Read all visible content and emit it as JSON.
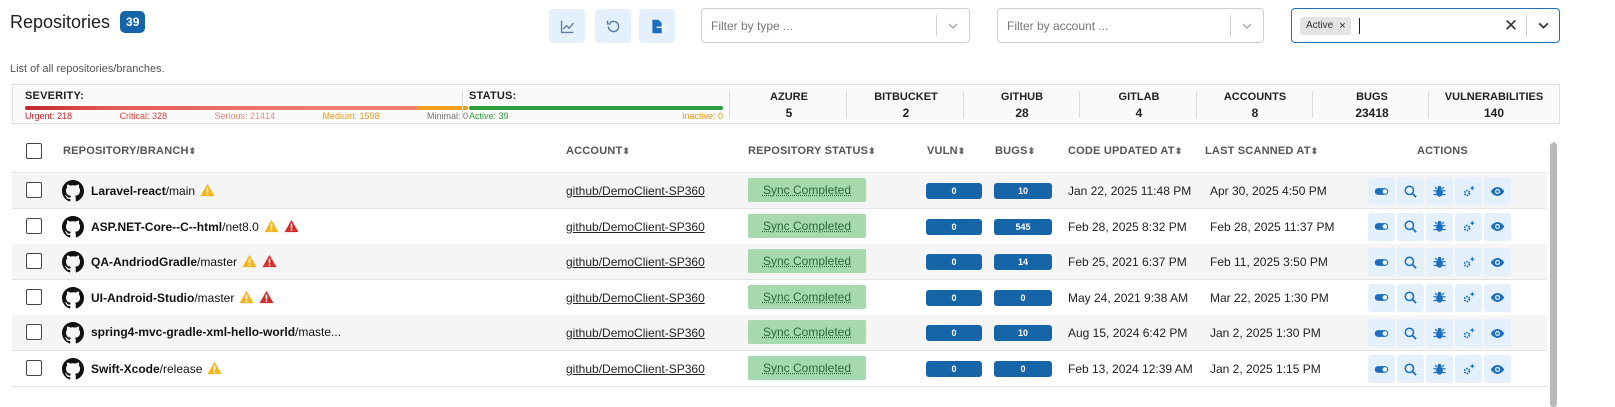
{
  "header": {
    "title": "Repositories",
    "count": "39",
    "subtitle": "List of all repositories/branches."
  },
  "toolbar": {
    "buttons": [
      {
        "icon": "chart-line-icon"
      },
      {
        "icon": "refresh-icon"
      },
      {
        "icon": "export-icon"
      }
    ]
  },
  "filters": {
    "type_placeholder": "Filter by type ...",
    "account_placeholder": "Filter by account ...",
    "status_chip": "Active",
    "status_chip_remove": "×",
    "status_clear": "✕"
  },
  "summary": {
    "severity_label": "SEVERITY:",
    "severity": [
      {
        "label": "Urgent: 218"
      },
      {
        "label": "Critical: 328"
      },
      {
        "label": "Serious: 21414"
      },
      {
        "label": "Medium: 1598"
      },
      {
        "label": "Minimal: 0"
      }
    ],
    "status_label": "STATUS:",
    "status_active": "Active: 39",
    "status_inactive": "Inactive: 0",
    "stats": [
      {
        "label": "AZURE",
        "value": "5"
      },
      {
        "label": "BITBUCKET",
        "value": "2"
      },
      {
        "label": "GITHUB",
        "value": "28"
      },
      {
        "label": "GITLAB",
        "value": "4"
      },
      {
        "label": "ACCOUNTS",
        "value": "8"
      },
      {
        "label": "BUGS",
        "value": "23418"
      },
      {
        "label": "VULNERABILITIES",
        "value": "140"
      }
    ]
  },
  "table": {
    "columns": {
      "repo": "REPOSITORY/BRANCH",
      "account": "ACCOUNT",
      "status": "REPOSITORY STATUS",
      "vuln": "VULN",
      "bugs": "BUGS",
      "code_updated": "CODE UPDATED AT",
      "last_scanned": "LAST SCANNED AT",
      "actions": "ACTIONS"
    },
    "rows": [
      {
        "name": "Laravel-react",
        "branch": "/main",
        "warn": true,
        "alert": false,
        "account": "github/DemoClient-SP360",
        "status": "Sync Completed",
        "vuln": "0",
        "bugs": "10",
        "updated": "Jan 22, 2025 11:48 PM",
        "scanned": "Apr 30, 2025 4:50 PM"
      },
      {
        "name": "ASP.NET-Core--C--html",
        "branch": "/net8.0",
        "warn": true,
        "alert": true,
        "account": "github/DemoClient-SP360",
        "status": "Sync Completed",
        "vuln": "0",
        "bugs": "545",
        "updated": "Feb 28, 2025 8:32 PM",
        "scanned": "Feb 28, 2025 11:37 PM"
      },
      {
        "name": "QA-AndriodGradle",
        "branch": "/master",
        "warn": true,
        "alert": true,
        "account": "github/DemoClient-SP360",
        "status": "Sync Completed",
        "vuln": "0",
        "bugs": "14",
        "updated": "Feb 25, 2021 6:37 PM",
        "scanned": "Feb 11, 2025 3:50 PM"
      },
      {
        "name": "UI-Android-Studio",
        "branch": "/master",
        "warn": true,
        "alert": true,
        "account": "github/DemoClient-SP360",
        "status": "Sync Completed",
        "vuln": "0",
        "bugs": "0",
        "updated": "May 24, 2021 9:38 AM",
        "scanned": "Mar 22, 2025 1:30 PM"
      },
      {
        "name": "spring4-mvc-gradle-xml-hello-world",
        "branch": "/maste...",
        "warn": false,
        "alert": false,
        "account": "github/DemoClient-SP360",
        "status": "Sync Completed",
        "vuln": "0",
        "bugs": "10",
        "updated": "Aug 15, 2024 6:42 PM",
        "scanned": "Jan 2, 2025 1:30 PM"
      },
      {
        "name": "Swift-Xcode",
        "branch": "/release",
        "warn": true,
        "alert": false,
        "account": "github/DemoClient-SP360",
        "status": "Sync Completed",
        "vuln": "0",
        "bugs": "0",
        "updated": "Feb 13, 2024 12:39 AM",
        "scanned": "Jan 2, 2025 1:15 PM"
      }
    ],
    "action_icons": [
      "toggle-icon",
      "search-icon",
      "bug-icon",
      "settings-sparkle-icon",
      "eye-icon"
    ]
  },
  "colors": {
    "accent": "#1565a8",
    "sync_bg": "#a6d9ad",
    "warn": "#f5b51e",
    "alert": "#d32f2f"
  }
}
